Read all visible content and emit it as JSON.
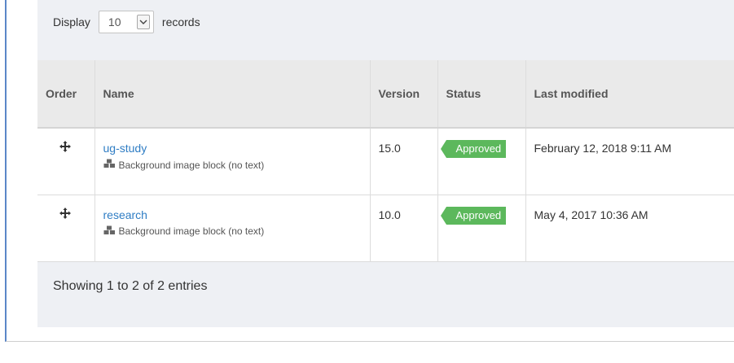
{
  "display": {
    "label": "Display",
    "select_value": "10",
    "suffix": "records"
  },
  "table": {
    "headers": {
      "order": "Order",
      "name": "Name",
      "version": "Version",
      "status": "Status",
      "modified": "Last modified"
    },
    "rows": [
      {
        "name": "ug-study",
        "subtitle": "Background image block (no text)",
        "version": "15.0",
        "status": "Approved",
        "modified": "February 12, 2018 9:11 AM"
      },
      {
        "name": "research",
        "subtitle": "Background image block (no text)",
        "version": "10.0",
        "status": "Approved",
        "modified": "May 4, 2017 10:36 AM"
      }
    ]
  },
  "footer": {
    "summary": "Showing 1 to 2 of 2 entries"
  },
  "colors": {
    "accent_blue": "#2f7dc4",
    "status_green": "#5cb85c",
    "frame_border": "#5b87c8"
  },
  "icons": {
    "drag": "move-arrows-icon",
    "block": "cubes-icon",
    "dropdown": "chevron-down-icon"
  }
}
